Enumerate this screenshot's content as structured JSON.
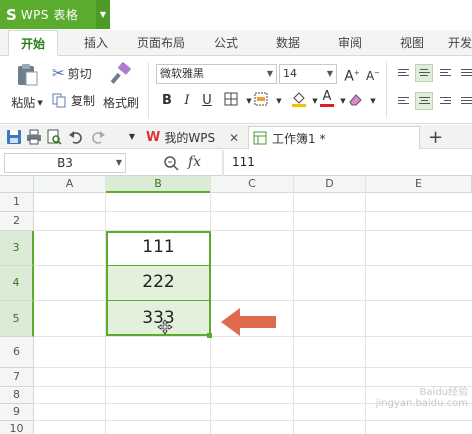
{
  "titlebar": {
    "app_logo": "S",
    "app_title": "WPS 表格"
  },
  "tabs": [
    "开始",
    "插入",
    "页面布局",
    "公式",
    "数据",
    "审阅",
    "视图",
    "开发"
  ],
  "ribbon": {
    "paste_label": "粘贴",
    "cut_label": "剪切",
    "copy_label": "复制",
    "format_painter_label": "格式刷",
    "font_name": "微软雅黑",
    "font_size": "14"
  },
  "doc_tabs": {
    "wps_tab_label": "我的WPS",
    "book_tab_label": "工作簿1 *"
  },
  "formula_bar": {
    "cell_ref": "B3",
    "fx_label": "fx",
    "formula_value": "111"
  },
  "sheet": {
    "columns": [
      "A",
      "B",
      "C",
      "D",
      "E"
    ],
    "rows": [
      "1",
      "2",
      "3",
      "4",
      "5",
      "6",
      "7",
      "8",
      "9",
      "10"
    ],
    "cells": {
      "B3": "111",
      "B4": "222",
      "B5": "333"
    }
  },
  "colors": {
    "accent": "#5aab2e",
    "selection_fill": "#e3f1dc",
    "arrow": "#e06a4d"
  },
  "watermark": "Baidu经验 jingyan.baidu.com"
}
